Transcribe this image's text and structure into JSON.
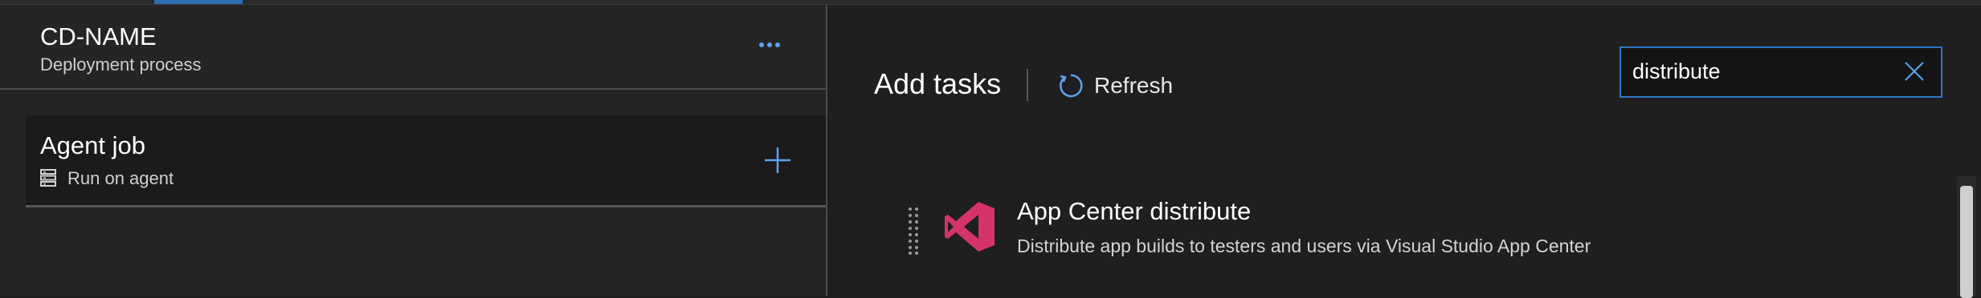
{
  "colors": {
    "accent": "#2b6cb5",
    "link_blue": "#5aa3f0",
    "icon_pink": "#d4336b"
  },
  "left": {
    "title": "CD-NAME",
    "subtitle": "Deployment process",
    "more_icon": "ellipsis-icon",
    "agent_job": {
      "title": "Agent job",
      "subtitle": "Run on agent",
      "icon": "server-icon",
      "add_icon": "plus-icon"
    }
  },
  "right": {
    "heading": "Add tasks",
    "refresh_label": "Refresh",
    "refresh_icon": "refresh-icon",
    "search": {
      "value": "distribute",
      "placeholder": "",
      "clear_icon": "close-icon"
    },
    "tasks": [
      {
        "title": "App Center distribute",
        "description": "Distribute app builds to testers and users via Visual Studio App Center",
        "icon": "visual-studio-app-center-icon"
      }
    ]
  }
}
